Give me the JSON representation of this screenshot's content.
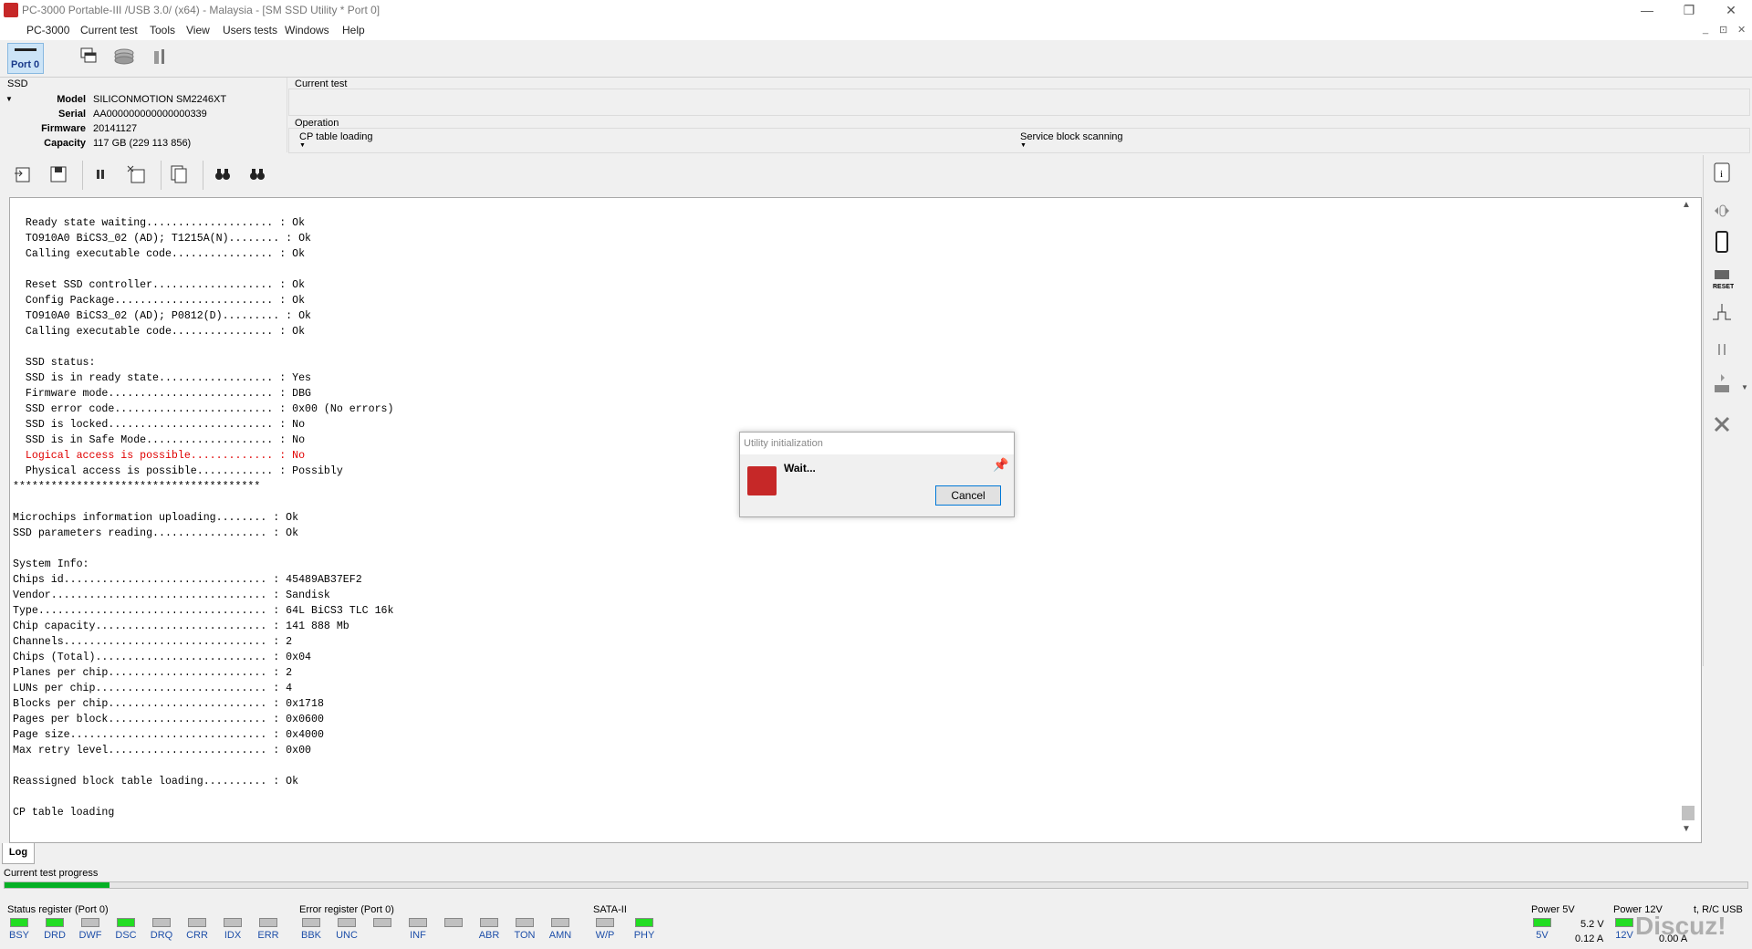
{
  "window": {
    "title": "PC-3000 Portable-III /USB 3.0/ (x64) - Malaysia - [SM SSD Utility * Port 0]",
    "minimize": "—",
    "restore": "❐",
    "close": "✕"
  },
  "menu": {
    "items": [
      "PC-3000",
      "Current test",
      "Tools",
      "View",
      "Users tests",
      "Windows",
      "Help"
    ],
    "mdi": [
      "_",
      "⊡",
      "✕"
    ]
  },
  "toolbar": {
    "port_label": "Port 0"
  },
  "ssd": {
    "group": "SSD",
    "model_label": "Model",
    "model": "SILICONMOTION SM2246XT",
    "serial_label": "Serial",
    "serial": "AA000000000000000339",
    "firmware_label": "Firmware",
    "firmware": "20141127",
    "capacity_label": "Capacity",
    "capacity": "117 GB (229 113 856)"
  },
  "current_test": {
    "title": "Current test"
  },
  "operation": {
    "title": "Operation",
    "left": "CP table loading",
    "right": "Service block scanning"
  },
  "log": {
    "lines": [
      {
        "t": "  Ready state waiting.................... : Ok"
      },
      {
        "t": "  TO910A0 BiCS3_02 (AD); T1215A(N)........ : Ok"
      },
      {
        "t": "  Calling executable code................ : Ok"
      },
      {
        "t": ""
      },
      {
        "t": "  Reset SSD controller................... : Ok"
      },
      {
        "t": "  Config Package......................... : Ok"
      },
      {
        "t": "  TO910A0 BiCS3_02 (AD); P0812(D)......... : Ok"
      },
      {
        "t": "  Calling executable code................ : Ok"
      },
      {
        "t": ""
      },
      {
        "t": "  SSD status:"
      },
      {
        "t": "  SSD is in ready state.................. : Yes"
      },
      {
        "t": "  Firmware mode.......................... : DBG"
      },
      {
        "t": "  SSD error code......................... : 0x00 (No errors)"
      },
      {
        "t": "  SSD is locked.......................... : No"
      },
      {
        "t": "  SSD is in Safe Mode.................... : No"
      },
      {
        "t": "  Logical access is possible............. : No",
        "red": true
      },
      {
        "t": "  Physical access is possible............ : Possibly"
      },
      {
        "t": "***************************************"
      },
      {
        "t": ""
      },
      {
        "t": "Microchips information uploading........ : Ok"
      },
      {
        "t": "SSD parameters reading.................. : Ok"
      },
      {
        "t": ""
      },
      {
        "t": "System Info:"
      },
      {
        "t": "Chips id................................ : 45489AB37EF2"
      },
      {
        "t": "Vendor.................................. : Sandisk"
      },
      {
        "t": "Type.................................... : 64L BiCS3 TLC 16k"
      },
      {
        "t": "Chip capacity........................... : 141 888 Mb"
      },
      {
        "t": "Channels................................ : 2"
      },
      {
        "t": "Chips (Total)........................... : 0x04"
      },
      {
        "t": "Planes per chip......................... : 2"
      },
      {
        "t": "LUNs per chip........................... : 4"
      },
      {
        "t": "Blocks per chip......................... : 0x1718"
      },
      {
        "t": "Pages per block......................... : 0x0600"
      },
      {
        "t": "Page size............................... : 0x4000"
      },
      {
        "t": "Max retry level......................... : 0x00"
      },
      {
        "t": ""
      },
      {
        "t": "Reassigned block table loading.......... : Ok"
      },
      {
        "t": ""
      },
      {
        "t": "CP table loading"
      }
    ],
    "tab": "Log"
  },
  "progress": {
    "label": "Current test progress",
    "fraction": 0.06
  },
  "status_register": {
    "title": "Status register (Port 0)",
    "leds": [
      {
        "label": "BSY",
        "on": true
      },
      {
        "label": "DRD",
        "on": true
      },
      {
        "label": "DWF",
        "on": false
      },
      {
        "label": "DSC",
        "on": true
      },
      {
        "label": "DRQ",
        "on": false
      },
      {
        "label": "CRR",
        "on": false
      },
      {
        "label": "IDX",
        "on": false
      },
      {
        "label": "ERR",
        "on": false
      }
    ]
  },
  "error_register": {
    "title": "Error register (Port 0)",
    "leds": [
      {
        "label": "BBK",
        "on": false
      },
      {
        "label": "UNC",
        "on": false
      },
      {
        "label": "",
        "on": false
      },
      {
        "label": "INF",
        "on": false
      },
      {
        "label": "",
        "on": false
      },
      {
        "label": "ABR",
        "on": false
      },
      {
        "label": "TON",
        "on": false
      },
      {
        "label": "AMN",
        "on": false
      }
    ]
  },
  "sata": {
    "title": "SATA-II",
    "leds": [
      {
        "label": "W/P",
        "on": false
      },
      {
        "label": "PHY",
        "on": true
      }
    ]
  },
  "power5": {
    "title": "Power 5V",
    "led_label": "5V",
    "voltage": "5.2 V",
    "current": "0.12 A"
  },
  "power12": {
    "title": "Power 12V",
    "led_label": "12V",
    "voltage": "",
    "current": "0.00 A"
  },
  "rcusb": {
    "title": "t, R/C USB"
  },
  "dialog": {
    "title": "Utility initialization",
    "message": "Wait...",
    "cancel": "Cancel"
  },
  "watermark": "Discuz!",
  "colors": {
    "led_on": "#22dd22",
    "led_off": "#c0c0c0",
    "accent": "#0078d7",
    "brand": "#c62828",
    "error_text": "#e00000"
  }
}
